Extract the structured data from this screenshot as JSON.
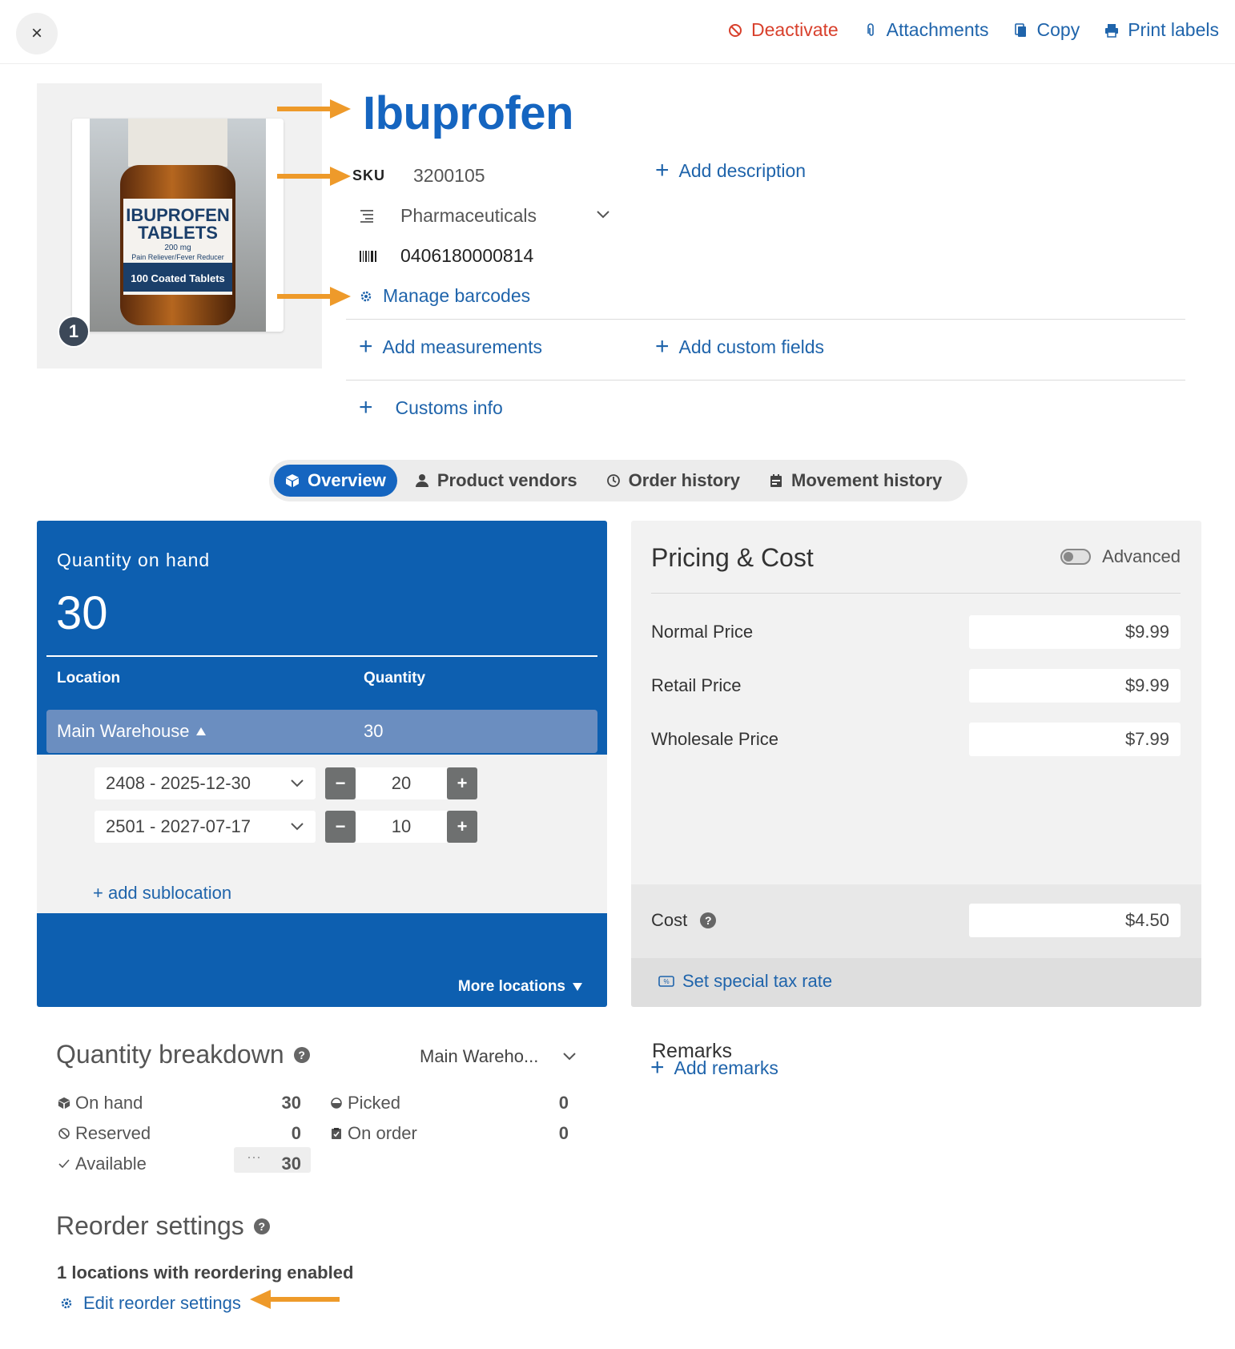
{
  "header": {
    "close_label": "×",
    "actions": [
      {
        "label": "Deactivate",
        "icon": "ban-icon",
        "color": "#d8402c"
      },
      {
        "label": "Attachments",
        "icon": "paperclip-icon"
      },
      {
        "label": "Copy",
        "icon": "copy-icon"
      },
      {
        "label": "Print labels",
        "icon": "printer-icon"
      }
    ]
  },
  "product": {
    "image_count": "1",
    "image_text": {
      "brand": "IBUPROFEN",
      "form": "TABLETS",
      "strength": "200 mg",
      "use": "Pain Reliever/Fever Reducer",
      "count": "100 Coated Tablets"
    },
    "title": "Ibuprofen",
    "sku_label": "SKU",
    "sku": "3200105",
    "category": "Pharmaceuticals",
    "barcode": "0406180000814",
    "manage_barcodes": "Manage barcodes",
    "add_description": "Add description",
    "add_measurements": "Add measurements",
    "add_custom_fields": "Add custom fields",
    "customs_info": "Customs info"
  },
  "tabs": [
    {
      "label": "Overview",
      "icon": "box-icon",
      "active": true
    },
    {
      "label": "Product vendors",
      "icon": "person-icon"
    },
    {
      "label": "Order history",
      "icon": "clock-icon"
    },
    {
      "label": "Movement history",
      "icon": "calendar-icon"
    }
  ],
  "quantity": {
    "title": "Quantity on hand",
    "total": "30",
    "col_location": "Location",
    "col_quantity": "Quantity",
    "location": {
      "name": "Main Warehouse",
      "qty": "30"
    },
    "sublocations": [
      {
        "label": "2408 - 2025-12-30",
        "qty": "20"
      },
      {
        "label": "2501 - 2027-07-17",
        "qty": "10"
      }
    ],
    "add_sublocation": "+ add sublocation",
    "more_locations": "More locations",
    "accent": "#0d5fb0"
  },
  "pricing": {
    "title": "Pricing & Cost",
    "advanced_label": "Advanced",
    "rows": [
      {
        "label": "Normal Price",
        "value": "$9.99"
      },
      {
        "label": "Retail Price",
        "value": "$9.99"
      },
      {
        "label": "Wholesale Price",
        "value": "$7.99"
      }
    ],
    "cost_label": "Cost",
    "cost_value": "$4.50",
    "tax_link": "Set special tax rate"
  },
  "breakdown": {
    "title": "Quantity breakdown",
    "location_select": "Main Wareho...",
    "on_hand_label": "On hand",
    "on_hand": "30",
    "reserved_label": "Reserved",
    "reserved": "0",
    "available_label": "Available",
    "available": "30",
    "picked_label": "Picked",
    "picked": "0",
    "on_order_label": "On order",
    "on_order": "0",
    "dots": "···"
  },
  "remarks": {
    "title": "Remarks",
    "add": "Add remarks"
  },
  "reorder": {
    "title": "Reorder settings",
    "subtitle": "1 locations with reordering enabled",
    "edit": "Edit reorder settings"
  },
  "annotation_color": "#ee9a2a"
}
